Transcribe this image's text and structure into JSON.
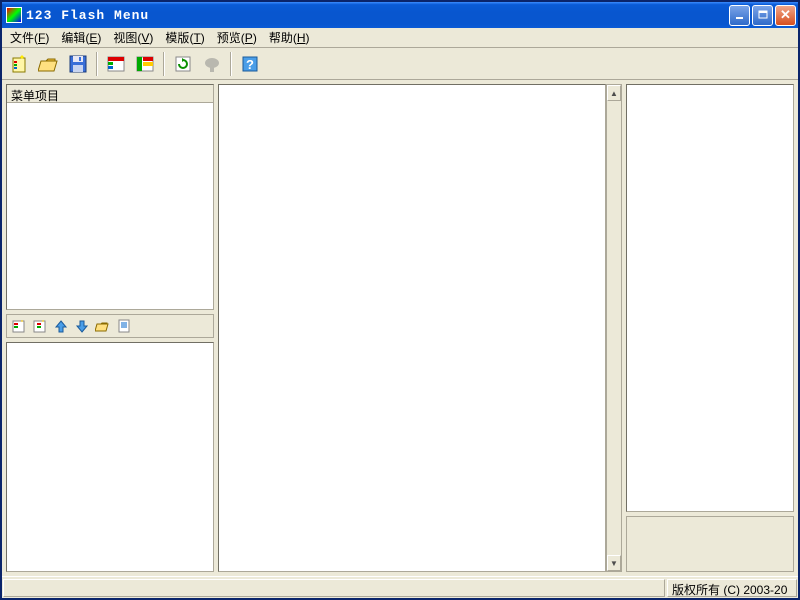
{
  "window": {
    "title": "123 Flash Menu"
  },
  "menubar": [
    {
      "label": "文件",
      "mnemonic": "F"
    },
    {
      "label": "编辑",
      "mnemonic": "E"
    },
    {
      "label": "视图",
      "mnemonic": "V"
    },
    {
      "label": "模版",
      "mnemonic": "T"
    },
    {
      "label": "预览",
      "mnemonic": "P"
    },
    {
      "label": "帮助",
      "mnemonic": "H"
    }
  ],
  "toolbar": [
    {
      "name": "new",
      "type": "new"
    },
    {
      "name": "open",
      "type": "open"
    },
    {
      "name": "save",
      "type": "save"
    },
    {
      "sep": true
    },
    {
      "name": "template1",
      "type": "tpl1"
    },
    {
      "name": "template2",
      "type": "tpl2"
    },
    {
      "sep": true
    },
    {
      "name": "refresh",
      "type": "refresh"
    },
    {
      "name": "preview",
      "type": "preview",
      "disabled": true
    },
    {
      "sep": true
    },
    {
      "name": "help",
      "type": "help"
    }
  ],
  "treePanel": {
    "header": "菜单项目"
  },
  "treeToolbar": [
    {
      "name": "add-item",
      "type": "additem"
    },
    {
      "name": "add-subitem",
      "type": "addsub"
    },
    {
      "name": "move-up",
      "type": "up"
    },
    {
      "name": "move-down",
      "type": "down"
    },
    {
      "name": "import",
      "type": "import"
    },
    {
      "name": "properties",
      "type": "props"
    }
  ],
  "statusbar": {
    "copyright": "版权所有 (C) 2003-20"
  }
}
